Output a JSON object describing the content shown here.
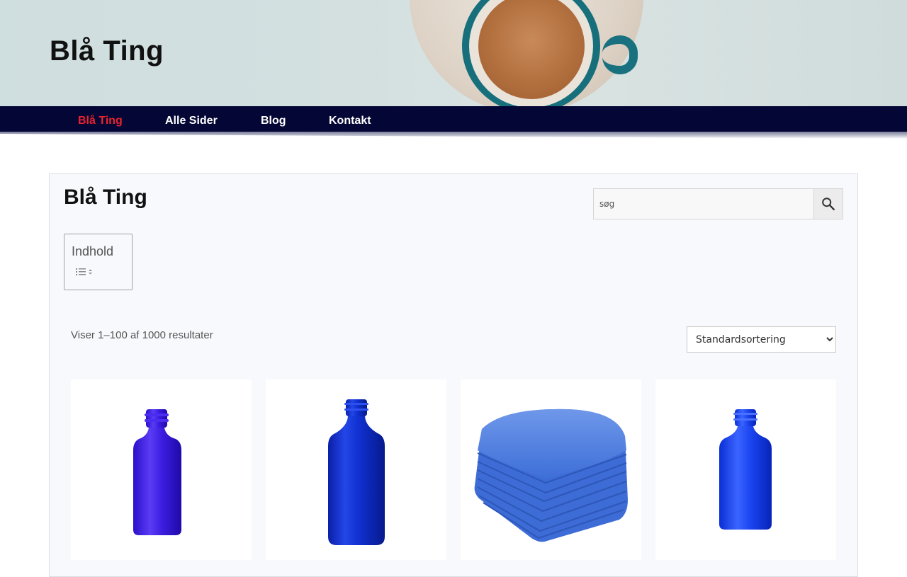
{
  "site": {
    "title": "Blå Ting"
  },
  "nav": {
    "items": [
      {
        "label": "Blå Ting",
        "active": true
      },
      {
        "label": "Alle Sider",
        "active": false
      },
      {
        "label": "Blog",
        "active": false
      },
      {
        "label": "Kontakt",
        "active": false
      }
    ],
    "active_color": "#e8232e",
    "bar_color": "#040635"
  },
  "page": {
    "title": "Blå Ting"
  },
  "search": {
    "placeholder": "søg",
    "icon": "search-icon"
  },
  "toc": {
    "title": "Indhold",
    "icon": "toc-toggle-icon"
  },
  "shop": {
    "result_count": "Viser 1–100 af 1000 resultater",
    "sort_selected": "Standardsortering"
  },
  "products": [
    {
      "image": "blue-dropper-bottle"
    },
    {
      "image": "blue-tall-bottle"
    },
    {
      "image": "blue-microfiber-towels"
    },
    {
      "image": "blue-small-bottle"
    }
  ]
}
